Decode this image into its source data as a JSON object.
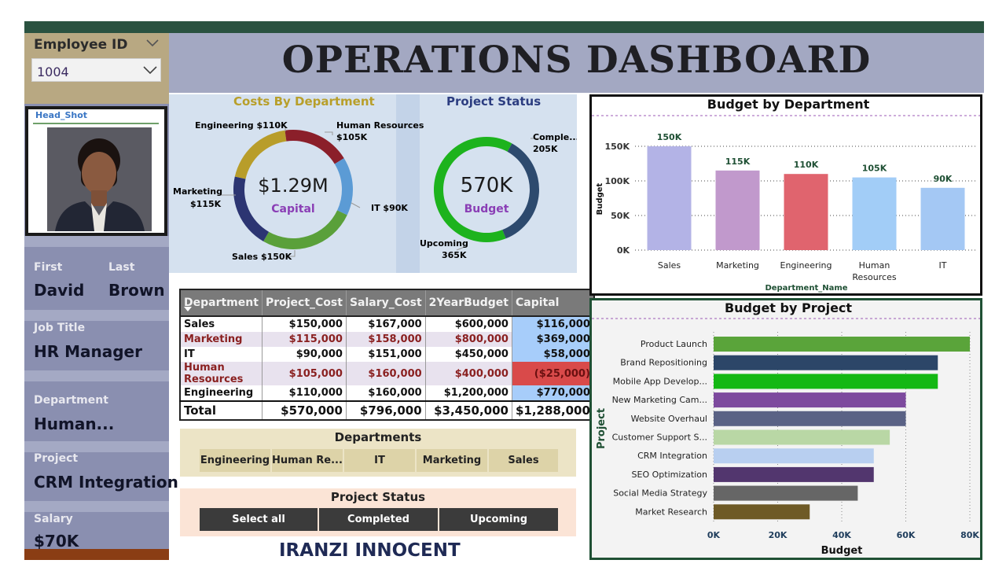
{
  "title": "OPERATIONS DASHBOARD",
  "employee": {
    "id_label": "Employee ID",
    "id_value": "1004",
    "photo_title": "Head_Shot",
    "first_label": "First",
    "first_value": "David",
    "last_label": "Last",
    "last_value": "Brown",
    "job_label": "Job Title",
    "job_value": "HR Manager",
    "dept_label": "Department",
    "dept_value": "Human...",
    "project_label": "Project",
    "project_value": "CRM Integration",
    "salary_label": "Salary",
    "salary_value": "$70K"
  },
  "donut1": {
    "title": "Costs By Department",
    "center_value": "$1.29M",
    "center_label": "Capital",
    "labels": {
      "engineering": "Engineering $110K",
      "hr1": "Human Resources",
      "hr2": "$105K",
      "marketing1": "Marketing",
      "marketing2": "$115K",
      "it": "IT $90K",
      "sales": "Sales $150K"
    },
    "colors": [
      "#5aa03a",
      "#2c3572",
      "#b89d2a",
      "#8b1f2a",
      "#5b9bd5"
    ]
  },
  "donut2": {
    "title": "Project Status",
    "center_value": "570K",
    "center_label": "Budget",
    "completed1": "Comple...",
    "completed2": "205K",
    "upcoming1": "Upcoming",
    "upcoming2": "365K",
    "colors": [
      "#1db31d",
      "#2d4a6e"
    ]
  },
  "table": {
    "headers": [
      "Department",
      "Project_Cost",
      "Salary_Cost",
      "2YearBudget",
      "Capital"
    ],
    "rows": [
      [
        "Sales",
        "$150,000",
        "$167,000",
        "$600,000",
        "$116,000"
      ],
      [
        "Marketing",
        "$115,000",
        "$158,000",
        "$800,000",
        "$369,000"
      ],
      [
        "IT",
        "$90,000",
        "$151,000",
        "$450,000",
        "$58,000"
      ],
      [
        "Human Resources",
        "$105,000",
        "$160,000",
        "$400,000",
        "($25,000)"
      ],
      [
        "Engineering",
        "$110,000",
        "$160,000",
        "$1,200,000",
        "$770,000"
      ]
    ],
    "total": [
      "Total",
      "$570,000",
      "$796,000",
      "$3,450,000",
      "$1,288,000"
    ]
  },
  "slicer_departments": {
    "title": "Departments",
    "items": [
      "Engineering",
      "Human Re...",
      "IT",
      "Marketing",
      "Sales"
    ]
  },
  "slicer_status": {
    "title": "Project Status",
    "items": [
      "Select all",
      "Completed",
      "Upcoming"
    ]
  },
  "footer": "IRANZI INNOCENT",
  "chart_data": [
    {
      "type": "pie",
      "title": "Costs By Department",
      "categories": [
        "Sales",
        "Marketing",
        "Engineering",
        "Human Resources",
        "IT"
      ],
      "values": [
        150,
        115,
        110,
        105,
        90
      ],
      "unit": "K"
    },
    {
      "type": "pie",
      "title": "Project Status",
      "categories": [
        "Completed",
        "Upcoming"
      ],
      "values": [
        205,
        365
      ],
      "unit": "K"
    },
    {
      "type": "bar",
      "title": "Budget by Department",
      "categories": [
        "Sales",
        "Marketing",
        "Engineering",
        "Human Resources",
        "IT"
      ],
      "category_lines": [
        [
          "Sales"
        ],
        [
          "Marketing"
        ],
        [
          "Engineering"
        ],
        [
          "Human",
          "Resources"
        ],
        [
          "IT"
        ]
      ],
      "values": [
        150,
        115,
        110,
        105,
        90
      ],
      "data_labels": [
        "150K",
        "115K",
        "110K",
        "105K",
        "90K"
      ],
      "colors": [
        "#b3b3e6",
        "#c199cc",
        "#e0646e",
        "#a2cdf7",
        "#a4c8f4"
      ],
      "xlabel": "Department_Name",
      "ylabel": "Budget",
      "ylim": [
        0,
        150
      ],
      "yticks": [
        "0K",
        "50K",
        "100K",
        "150K"
      ]
    },
    {
      "type": "bar",
      "orientation": "horizontal",
      "title": "Budget by Project",
      "categories": [
        "Product Launch",
        "Brand Repositioning",
        "Mobile App Develop...",
        "New Marketing Cam...",
        "Website Overhaul",
        "Customer Support S...",
        "CRM Integration",
        "SEO Optimization",
        "Social Media Strategy",
        "Market Research"
      ],
      "values": [
        80,
        70,
        70,
        60,
        60,
        55,
        50,
        50,
        45,
        30
      ],
      "colors": [
        "#5aa43a",
        "#2c4668",
        "#14b814",
        "#7d4a9e",
        "#5a6285",
        "#b9d7a5",
        "#b8cff0",
        "#52366e",
        "#666666",
        "#6e5a26"
      ],
      "xlabel": "Budget",
      "ylabel": "Project",
      "xlim": [
        0,
        80
      ],
      "xticks": [
        "0K",
        "20K",
        "40K",
        "60K",
        "80K"
      ]
    }
  ]
}
